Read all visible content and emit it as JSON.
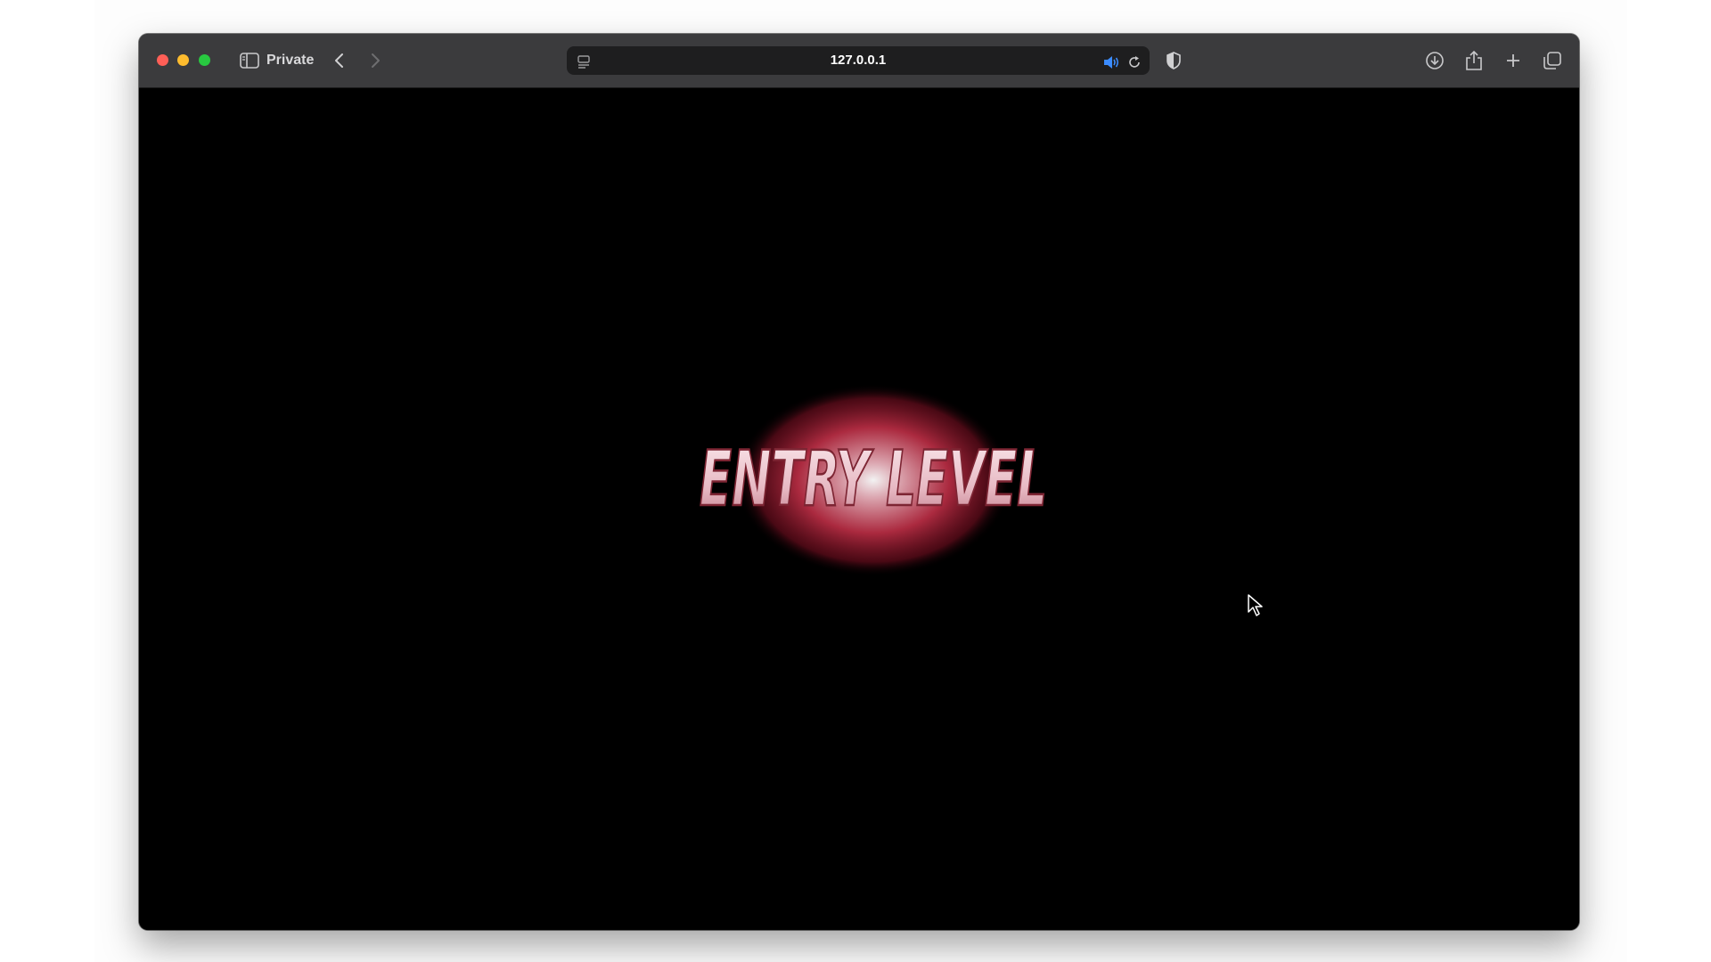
{
  "browser": {
    "mode_label": "Private",
    "url": "127.0.0.1",
    "icons": {
      "sidebar": "sidebar-toggle-icon",
      "back": "chevron-left-icon",
      "forward": "chevron-right-icon",
      "page_menu": "page-menu-icon",
      "audio": "speaker-icon",
      "reload": "reload-icon",
      "privacy": "privacy-shield-icon",
      "downloads": "download-icon",
      "share": "share-icon",
      "new_tab": "plus-icon",
      "tab_overview": "tabs-overview-icon"
    }
  },
  "page": {
    "logo_text": "ENTRY LEVEL",
    "background": "#000000",
    "logo_colors": {
      "glow": "#c9314a",
      "text": "#f1d8de"
    }
  }
}
